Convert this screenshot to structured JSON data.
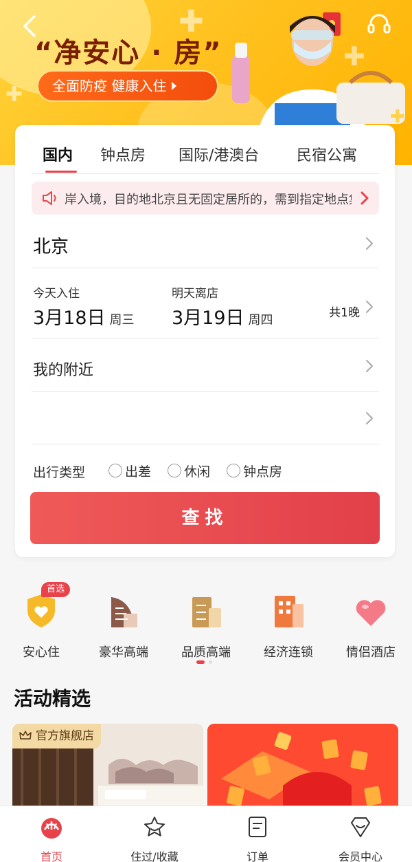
{
  "banner": {
    "slogan": "“净安心 · 房”",
    "pill": "全面防疫  健康入住"
  },
  "tabs": [
    {
      "label": "国内",
      "active": true
    },
    {
      "label": "钟点房",
      "active": false
    },
    {
      "label": "国际/港澳台",
      "active": false
    },
    {
      "label": "民宿公寓",
      "active": false
    }
  ],
  "notice": {
    "text": "岸入境，目的地北京且无固定居所的，需到指定地点集中隔离"
  },
  "destination": {
    "city": "北京"
  },
  "dates": {
    "checkin_label": "今天入住",
    "checkin_date": "3月18日",
    "checkin_week": "周三",
    "checkout_label": "明天离店",
    "checkout_date": "3月19日",
    "checkout_week": "周四",
    "nights": "共1晚"
  },
  "nearby": {
    "label": "我的附近"
  },
  "keyword": {
    "value": ""
  },
  "trip_type": {
    "label": "出行类型",
    "options": [
      "出差",
      "休闲",
      "钟点房"
    ]
  },
  "search_button": "查找",
  "categories": [
    {
      "label": "安心住",
      "icon": "shield-heart-icon",
      "badge": "首选"
    },
    {
      "label": "豪华高端",
      "icon": "luxury-building-icon"
    },
    {
      "label": "品质高端",
      "icon": "quality-building-icon"
    },
    {
      "label": "经济连锁",
      "icon": "budget-building-icon"
    },
    {
      "label": "情侣酒店",
      "icon": "heart-icon"
    }
  ],
  "section": {
    "title": "活动精选"
  },
  "promos": [
    {
      "label": "官方旗舰店"
    }
  ],
  "bottom_nav": [
    {
      "label": "首页",
      "icon": "home-icon",
      "active": true
    },
    {
      "label": "住过/收藏",
      "icon": "star-icon",
      "active": false
    },
    {
      "label": "订单",
      "icon": "order-icon",
      "active": false
    },
    {
      "label": "会员中心",
      "icon": "member-icon",
      "active": false
    }
  ],
  "colors": {
    "accent": "#e8424a",
    "banner": "#ffc11f"
  }
}
